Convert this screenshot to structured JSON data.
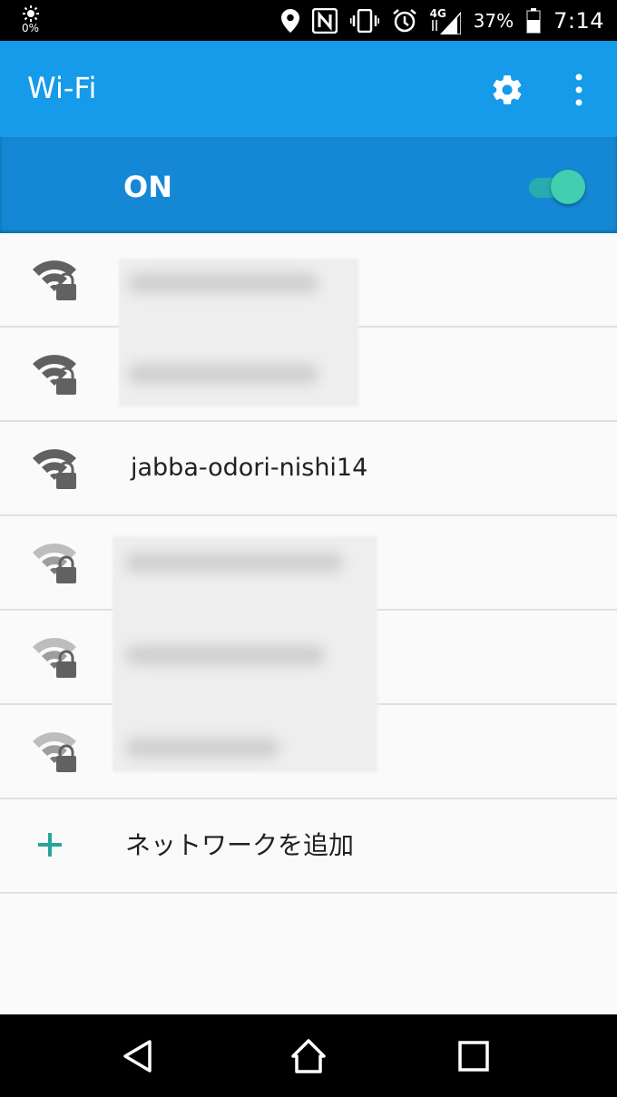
{
  "status_bar": {
    "brightness_pct": "0%",
    "network_type": "4G",
    "battery_pct": "37%",
    "time": "7:14",
    "icons": [
      "location-icon",
      "nfc-icon",
      "vibrate-icon",
      "alarm-icon",
      "signal-icon",
      "battery-icon"
    ]
  },
  "app_bar": {
    "title": "Wi-Fi",
    "icons": [
      "gear-icon",
      "more-vert-icon"
    ]
  },
  "master_switch": {
    "label": "ON",
    "state": "on",
    "accent_color": "#42cfb0"
  },
  "networks": [
    {
      "ssid": "",
      "blurred": true,
      "secured": true,
      "signal": "strong"
    },
    {
      "ssid": "",
      "blurred": true,
      "secured": true,
      "signal": "strong"
    },
    {
      "ssid": "jabba-odori-nishi14",
      "blurred": false,
      "secured": true,
      "signal": "strong"
    },
    {
      "ssid": "",
      "blurred": true,
      "secured": true,
      "signal": "weak"
    },
    {
      "ssid": "",
      "blurred": true,
      "secured": true,
      "signal": "weak"
    },
    {
      "ssid": "",
      "blurred": true,
      "secured": true,
      "signal": "weak"
    }
  ],
  "add_network": {
    "label": "ネットワークを追加",
    "icon": "plus-icon",
    "icon_color": "#26a69a"
  },
  "nav_bar": {
    "icons": [
      "back-icon",
      "home-icon",
      "recents-icon"
    ]
  },
  "colors": {
    "app_bar": "#159be9",
    "switch_bar": "#1588d5"
  }
}
